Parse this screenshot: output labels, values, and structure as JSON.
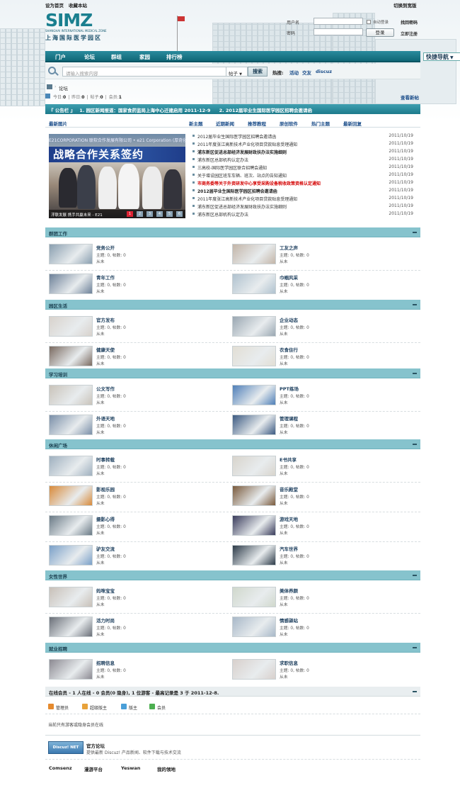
{
  "top": {
    "set_home": "设为首页",
    "bookmark": "收藏本站",
    "switch_style": "切换到宽版"
  },
  "logo": {
    "main": "SIMZ",
    "sub": "SHANGHAI INTERNATIONAL MEDICAL ZONE",
    "cn": "上海国际医学园区"
  },
  "login": {
    "username_label": "用户名",
    "password_label": "密码",
    "auto_login": "自动登录",
    "forgot": "找回密码",
    "login_btn": "登录",
    "register": "立即注册"
  },
  "nav": {
    "items": [
      "门户",
      "论坛",
      "群组",
      "家园",
      "排行榜"
    ],
    "quick": "快捷导航"
  },
  "search": {
    "placeholder": "请输入搜索内容",
    "type": "帖子",
    "button": "搜索",
    "hot_label": "热搜:",
    "hot": [
      "活动",
      "交友",
      "discuz"
    ]
  },
  "breadcrumb": {
    "current": "论坛"
  },
  "stats": {
    "today_label": "今日:",
    "today": "0",
    "yesterday_label": "昨日:",
    "yesterday": "0",
    "posts_label": "帖子:",
    "posts": "0",
    "members_label": "会员:",
    "members": "1",
    "new_posts": "查看新帖"
  },
  "notice": {
    "label": "『 公告栏 』",
    "items": [
      "1.  园区新闻报道：国家食药监局上海中心迁建启用  2011-12-9",
      "2.  2012届毕业生国际医学园区招聘会邀请函"
    ]
  },
  "tabs": {
    "pictures": "最新图片",
    "items": [
      "新主题",
      "近期新闻",
      "推荐教程",
      "原创软件",
      "热门主题",
      "最新回复"
    ]
  },
  "slide": {
    "top": "E21CORPORATION 联软合作发展有限公司  • e21 Corporation (厚奇创新) • 上海浦东",
    "banner": "战略合作关系签约",
    "caption": "浮联发展 携手共赢未来 - E21",
    "pages": [
      "1",
      "2",
      "3",
      "4",
      "5",
      "6"
    ]
  },
  "news": [
    {
      "title": "2012届毕业生国际医学园区招聘会邀请函",
      "date": "2011/10/19",
      "style": "normal"
    },
    {
      "title": "2011年度张江高新技术产业化项目贷款贴息受理通知",
      "date": "2011/10/19",
      "style": "normal"
    },
    {
      "title": "浦东新区促进总部经济发展财政扶办法实施细则",
      "date": "2011/10/19",
      "style": "bold"
    },
    {
      "title": "浦东新区总部机构认定办法",
      "date": "2011/10/19",
      "style": "normal"
    },
    {
      "title": "三高校-国际医学园区联合招聘会通知",
      "date": "2011/10/19",
      "style": "normal"
    },
    {
      "title": "关于增设园区班车车辆、班次、站点的告知通知",
      "date": "2011/10/19",
      "style": "normal"
    },
    {
      "title": "市商务委等关于外资研发中心享受采购设备税收政策资格认定通知",
      "date": "2011/10/19",
      "style": "red"
    },
    {
      "title": "2012届毕业生国际医学园区招聘会邀请函",
      "date": "2011/10/19",
      "style": "bold"
    },
    {
      "title": "2011年度张江高新技术产业化项目贷款贴息受理通知",
      "date": "2011/10/19",
      "style": "normal"
    },
    {
      "title": "浦东新区促进总部经济发展财政扶办法实施细则",
      "date": "2011/10/19",
      "style": "normal"
    },
    {
      "title": "浦东新区总部机构认定办法",
      "date": "2011/10/19",
      "style": "normal"
    }
  ],
  "forum_common": {
    "stats": "主题: 0, 帖数: 0",
    "last": "从未"
  },
  "sections": [
    {
      "title": "群团工作",
      "forums": [
        "党务公开",
        "工友之声",
        "青年工作",
        "巾帼风采"
      ]
    },
    {
      "title": "园区生活",
      "forums": [
        "官方发布",
        "企业动态",
        "健康天使",
        "衣食住行"
      ]
    },
    {
      "title": "学习培训",
      "forums": [
        "公文写作",
        "PPT练场",
        "外语天地",
        "管理课程"
      ]
    },
    {
      "title": "休闲广场",
      "forums": [
        "时事转载",
        "E书共享",
        "影视乐园",
        "音乐殿堂",
        "摄影心得",
        "游戏天地",
        "驴友交流",
        "汽车世界"
      ]
    },
    {
      "title": "女性世界",
      "forums": [
        "妈咪宝宝",
        "美体养颜",
        "活力时尚",
        "情感驿站"
      ]
    },
    {
      "title": "就业招聘",
      "forums": [
        "招聘信息",
        "求职信息"
      ]
    }
  ],
  "online": {
    "summary": "在线会员 - 1 人在线  - 0 会员(0 隐身), 1 位游客  - 最高记录是  3  于  2011-12-8.",
    "legend": [
      "管理员",
      "超级版主",
      "版主",
      "会员"
    ],
    "empty": "当前只有游客或隐身会员在线"
  },
  "footer": {
    "badge": "Discuz! NET",
    "title": "官方论坛",
    "desc": "提供最新 Discuz! 产品新闻、软件下载与技术交流",
    "links": [
      "Comsenz",
      "漫游平台",
      "Yeswan",
      "我的领地"
    ]
  },
  "colors": {
    "nav": "#1c7a8b",
    "section": "#86c3cd",
    "link": "#1c4e8a",
    "red": "#d40000"
  }
}
